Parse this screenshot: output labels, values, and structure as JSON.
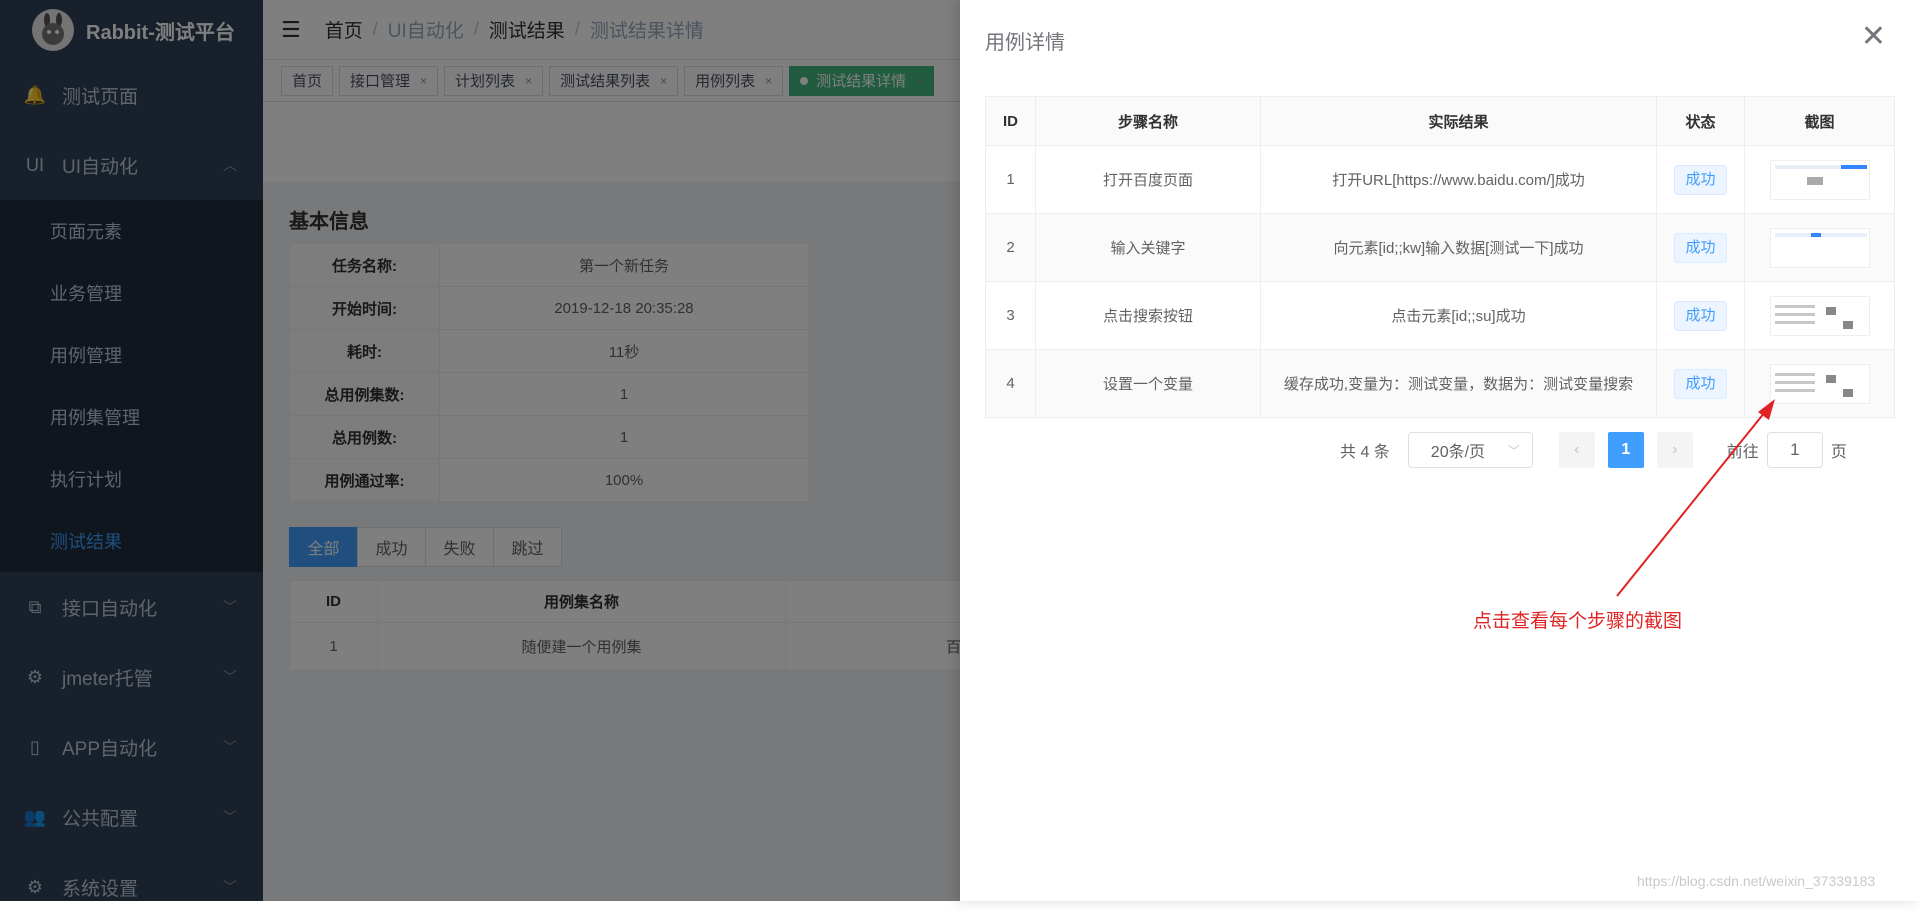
{
  "app": {
    "title": "Rabbit-测试平台"
  },
  "sidebar": {
    "items": [
      {
        "label": "测试页面",
        "icon": "bell-icon"
      },
      {
        "label": "UI自动化",
        "icon": "ui-icon",
        "prefix": "UI"
      },
      {
        "label": "接口自动化",
        "icon": "api-icon"
      },
      {
        "label": "jmeter托管",
        "icon": "gear-icon"
      },
      {
        "label": "APP自动化",
        "icon": "phone-icon"
      },
      {
        "label": "公共配置",
        "icon": "users-icon"
      },
      {
        "label": "系统设置",
        "icon": "settings-icon"
      }
    ],
    "sub_items": [
      {
        "label": "页面元素"
      },
      {
        "label": "业务管理"
      },
      {
        "label": "用例管理"
      },
      {
        "label": "用例集管理"
      },
      {
        "label": "执行计划"
      },
      {
        "label": "测试结果",
        "active": true
      }
    ]
  },
  "breadcrumb": [
    "首页",
    "UI自动化",
    "测试结果",
    "测试结果详情"
  ],
  "tags": [
    "首页",
    "接口管理",
    "计划列表",
    "测试结果列表",
    "用例列表",
    "测试结果详情"
  ],
  "basic_info": {
    "title": "基本信息",
    "rows": [
      {
        "key": "任务名称:",
        "value": "第一个新任务"
      },
      {
        "key": "开始时间:",
        "value": "2019-12-18 20:35:28"
      },
      {
        "key": "耗时:",
        "value": "11秒"
      },
      {
        "key": "总用例集数:",
        "value": "1"
      },
      {
        "key": "总用例数:",
        "value": "1"
      },
      {
        "key": "用例通过率:",
        "value": "100%"
      }
    ]
  },
  "filters": [
    "全部",
    "成功",
    "失败",
    "跳过"
  ],
  "set_table": {
    "headers": [
      "ID",
      "用例集名称"
    ],
    "rows": [
      {
        "id": "1",
        "name": "随便建一个用例集",
        "extra": "百"
      }
    ]
  },
  "drawer": {
    "title": "用例详情",
    "headers": [
      "ID",
      "步骤名称",
      "实际结果",
      "状态",
      "截图"
    ],
    "rows": [
      {
        "id": "1",
        "step": "打开百度页面",
        "result": "打开URL[https://www.baidu.com/]成功",
        "status": "成功"
      },
      {
        "id": "2",
        "step": "输入关键字",
        "result": "向元素[id;;kw]输入数据[测试一下]成功",
        "status": "成功"
      },
      {
        "id": "3",
        "step": "点击搜索按钮",
        "result": "点击元素[id;;su]成功",
        "status": "成功"
      },
      {
        "id": "4",
        "step": "设置一个变量",
        "result": "缓存成功,变量为：测试变量，数据为：测试变量搜索",
        "status": "成功"
      }
    ],
    "pagination": {
      "total": "共 4 条",
      "page_size": "20条/页",
      "current": "1",
      "goto_label": "前往",
      "goto_value": "1",
      "page_suffix": "页"
    }
  },
  "annotation": "点击查看每个步骤的截图",
  "watermark": "https://blog.csdn.net/weixin_37339183",
  "colors": {
    "sidebar": "#304156",
    "accent": "#409eff",
    "annotation": "#e02424",
    "active_tag": "#42b983"
  }
}
